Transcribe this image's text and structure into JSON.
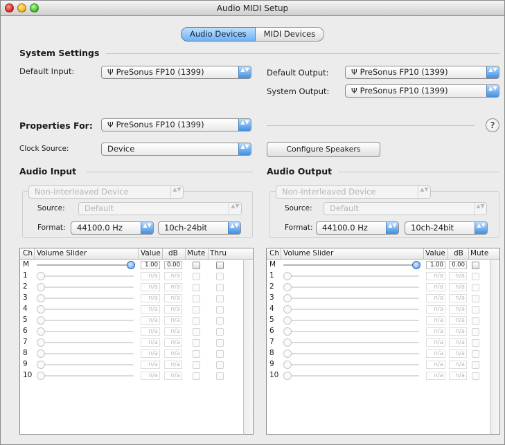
{
  "window": {
    "title": "Audio MIDI Setup"
  },
  "tabs": [
    {
      "label": "Audio Devices",
      "active": true
    },
    {
      "label": "MIDI Devices",
      "active": false
    }
  ],
  "system_settings": {
    "title": "System Settings",
    "default_input_label": "Default Input:",
    "default_input_value": "PreSonus FP10 (1399)",
    "default_output_label": "Default Output:",
    "default_output_value": "PreSonus FP10 (1399)",
    "system_output_label": "System Output:",
    "system_output_value": "PreSonus FP10 (1399)"
  },
  "properties": {
    "label": "Properties For:",
    "value": "PreSonus FP10 (1399)",
    "help": "?",
    "clock_source_label": "Clock Source:",
    "clock_source_value": "Device",
    "configure_speakers": "Configure Speakers"
  },
  "audio_input": {
    "title": "Audio Input",
    "interleave": "Non-Interleaved Device",
    "source_label": "Source:",
    "source_value": "Default",
    "format_label": "Format:",
    "format_rate": "44100.0 Hz",
    "format_bits": "10ch-24bit",
    "columns": [
      "Ch",
      "Volume Slider",
      "Value",
      "dB",
      "Mute",
      "Thru"
    ]
  },
  "audio_output": {
    "title": "Audio Output",
    "interleave": "Non-Interleaved Device",
    "source_label": "Source:",
    "source_value": "Default",
    "format_label": "Format:",
    "format_rate": "44100.0 Hz",
    "format_bits": "10ch-24bit",
    "columns": [
      "Ch",
      "Volume Slider",
      "Value",
      "dB",
      "Mute"
    ]
  },
  "channels": [
    {
      "ch": "M",
      "value": "1.00",
      "db": "0.00",
      "level": 1.0,
      "active": true
    },
    {
      "ch": "1",
      "value": "n/a",
      "db": "n/a",
      "level": 0.0,
      "active": false
    },
    {
      "ch": "2",
      "value": "n/a",
      "db": "n/a",
      "level": 0.0,
      "active": false
    },
    {
      "ch": "3",
      "value": "n/a",
      "db": "n/a",
      "level": 0.0,
      "active": false
    },
    {
      "ch": "4",
      "value": "n/a",
      "db": "n/a",
      "level": 0.0,
      "active": false
    },
    {
      "ch": "5",
      "value": "n/a",
      "db": "n/a",
      "level": 0.0,
      "active": false
    },
    {
      "ch": "6",
      "value": "n/a",
      "db": "n/a",
      "level": 0.0,
      "active": false
    },
    {
      "ch": "7",
      "value": "n/a",
      "db": "n/a",
      "level": 0.0,
      "active": false
    },
    {
      "ch": "8",
      "value": "n/a",
      "db": "n/a",
      "level": 0.0,
      "active": false
    },
    {
      "ch": "9",
      "value": "n/a",
      "db": "n/a",
      "level": 0.0,
      "active": false
    },
    {
      "ch": "10",
      "value": "n/a",
      "db": "n/a",
      "level": 0.0,
      "active": false
    }
  ],
  "icons": {
    "plug": "Ψ",
    "popup_arrows": "▲▼",
    "close": "close-icon",
    "minimize": "minimize-icon",
    "zoom": "zoom-icon"
  }
}
